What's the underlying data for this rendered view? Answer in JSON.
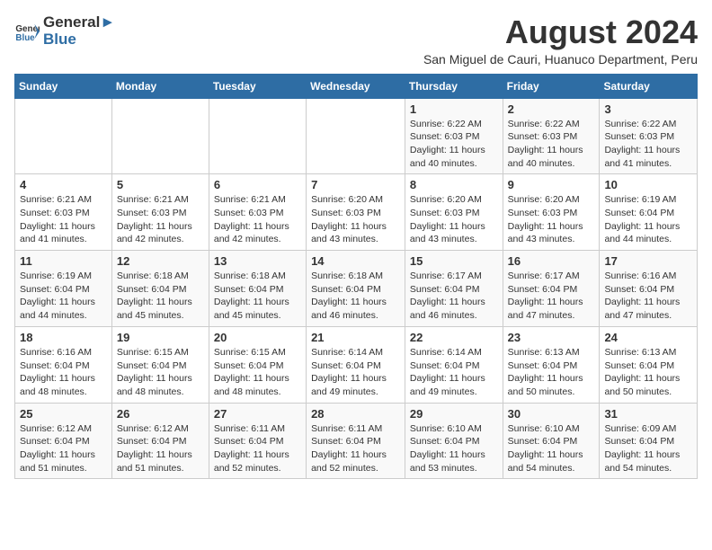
{
  "header": {
    "logo_general": "General",
    "logo_blue": "Blue",
    "month_year": "August 2024",
    "location": "San Miguel de Cauri, Huanuco Department, Peru"
  },
  "weekdays": [
    "Sunday",
    "Monday",
    "Tuesday",
    "Wednesday",
    "Thursday",
    "Friday",
    "Saturday"
  ],
  "weeks": [
    [
      {
        "day": "",
        "info": ""
      },
      {
        "day": "",
        "info": ""
      },
      {
        "day": "",
        "info": ""
      },
      {
        "day": "",
        "info": ""
      },
      {
        "day": "1",
        "sunrise": "6:22 AM",
        "sunset": "6:03 PM",
        "daylight": "11 hours and 40 minutes."
      },
      {
        "day": "2",
        "sunrise": "6:22 AM",
        "sunset": "6:03 PM",
        "daylight": "11 hours and 40 minutes."
      },
      {
        "day": "3",
        "sunrise": "6:22 AM",
        "sunset": "6:03 PM",
        "daylight": "11 hours and 41 minutes."
      }
    ],
    [
      {
        "day": "4",
        "sunrise": "6:21 AM",
        "sunset": "6:03 PM",
        "daylight": "11 hours and 41 minutes."
      },
      {
        "day": "5",
        "sunrise": "6:21 AM",
        "sunset": "6:03 PM",
        "daylight": "11 hours and 42 minutes."
      },
      {
        "day": "6",
        "sunrise": "6:21 AM",
        "sunset": "6:03 PM",
        "daylight": "11 hours and 42 minutes."
      },
      {
        "day": "7",
        "sunrise": "6:20 AM",
        "sunset": "6:03 PM",
        "daylight": "11 hours and 43 minutes."
      },
      {
        "day": "8",
        "sunrise": "6:20 AM",
        "sunset": "6:03 PM",
        "daylight": "11 hours and 43 minutes."
      },
      {
        "day": "9",
        "sunrise": "6:20 AM",
        "sunset": "6:03 PM",
        "daylight": "11 hours and 43 minutes."
      },
      {
        "day": "10",
        "sunrise": "6:19 AM",
        "sunset": "6:04 PM",
        "daylight": "11 hours and 44 minutes."
      }
    ],
    [
      {
        "day": "11",
        "sunrise": "6:19 AM",
        "sunset": "6:04 PM",
        "daylight": "11 hours and 44 minutes."
      },
      {
        "day": "12",
        "sunrise": "6:18 AM",
        "sunset": "6:04 PM",
        "daylight": "11 hours and 45 minutes."
      },
      {
        "day": "13",
        "sunrise": "6:18 AM",
        "sunset": "6:04 PM",
        "daylight": "11 hours and 45 minutes."
      },
      {
        "day": "14",
        "sunrise": "6:18 AM",
        "sunset": "6:04 PM",
        "daylight": "11 hours and 46 minutes."
      },
      {
        "day": "15",
        "sunrise": "6:17 AM",
        "sunset": "6:04 PM",
        "daylight": "11 hours and 46 minutes."
      },
      {
        "day": "16",
        "sunrise": "6:17 AM",
        "sunset": "6:04 PM",
        "daylight": "11 hours and 47 minutes."
      },
      {
        "day": "17",
        "sunrise": "6:16 AM",
        "sunset": "6:04 PM",
        "daylight": "11 hours and 47 minutes."
      }
    ],
    [
      {
        "day": "18",
        "sunrise": "6:16 AM",
        "sunset": "6:04 PM",
        "daylight": "11 hours and 48 minutes."
      },
      {
        "day": "19",
        "sunrise": "6:15 AM",
        "sunset": "6:04 PM",
        "daylight": "11 hours and 48 minutes."
      },
      {
        "day": "20",
        "sunrise": "6:15 AM",
        "sunset": "6:04 PM",
        "daylight": "11 hours and 48 minutes."
      },
      {
        "day": "21",
        "sunrise": "6:14 AM",
        "sunset": "6:04 PM",
        "daylight": "11 hours and 49 minutes."
      },
      {
        "day": "22",
        "sunrise": "6:14 AM",
        "sunset": "6:04 PM",
        "daylight": "11 hours and 49 minutes."
      },
      {
        "day": "23",
        "sunrise": "6:13 AM",
        "sunset": "6:04 PM",
        "daylight": "11 hours and 50 minutes."
      },
      {
        "day": "24",
        "sunrise": "6:13 AM",
        "sunset": "6:04 PM",
        "daylight": "11 hours and 50 minutes."
      }
    ],
    [
      {
        "day": "25",
        "sunrise": "6:12 AM",
        "sunset": "6:04 PM",
        "daylight": "11 hours and 51 minutes."
      },
      {
        "day": "26",
        "sunrise": "6:12 AM",
        "sunset": "6:04 PM",
        "daylight": "11 hours and 51 minutes."
      },
      {
        "day": "27",
        "sunrise": "6:11 AM",
        "sunset": "6:04 PM",
        "daylight": "11 hours and 52 minutes."
      },
      {
        "day": "28",
        "sunrise": "6:11 AM",
        "sunset": "6:04 PM",
        "daylight": "11 hours and 52 minutes."
      },
      {
        "day": "29",
        "sunrise": "6:10 AM",
        "sunset": "6:04 PM",
        "daylight": "11 hours and 53 minutes."
      },
      {
        "day": "30",
        "sunrise": "6:10 AM",
        "sunset": "6:04 PM",
        "daylight": "11 hours and 54 minutes."
      },
      {
        "day": "31",
        "sunrise": "6:09 AM",
        "sunset": "6:04 PM",
        "daylight": "11 hours and 54 minutes."
      }
    ]
  ]
}
